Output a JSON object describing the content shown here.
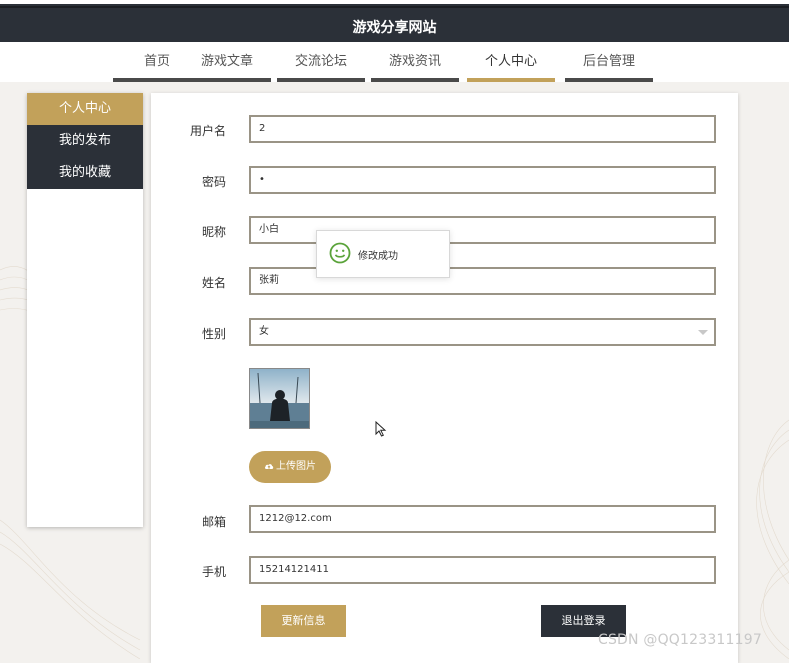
{
  "site": {
    "title": "游戏分享网站"
  },
  "nav": {
    "items": [
      {
        "label": "首页"
      },
      {
        "label": "游戏文章"
      },
      {
        "label": "交流论坛"
      },
      {
        "label": "游戏资讯"
      },
      {
        "label": "个人中心"
      },
      {
        "label": "后台管理"
      }
    ],
    "active": "个人中心"
  },
  "sidebar": {
    "items": [
      {
        "label": "个人中心"
      },
      {
        "label": "我的发布"
      },
      {
        "label": "我的收藏"
      }
    ]
  },
  "form": {
    "username": {
      "label": "用户名",
      "value": "2"
    },
    "password": {
      "label": "密码",
      "value": "•"
    },
    "nickname": {
      "label": "昵称",
      "value": "小白"
    },
    "name": {
      "label": "姓名",
      "value": "张莉"
    },
    "gender": {
      "label": "性别",
      "value": "女"
    },
    "upload_label": "上传图片",
    "email": {
      "label": "邮箱",
      "value": "1212@12.com"
    },
    "phone": {
      "label": "手机",
      "value": "15214121411"
    }
  },
  "buttons": {
    "update": "更新信息",
    "logout": "退出登录"
  },
  "toast": {
    "message": "修改成功",
    "icon": "smile-icon",
    "color": "#5aa33a"
  },
  "watermark": "CSDN @QQ123311197",
  "colors": {
    "accent": "#c2a15a",
    "dark": "#2b3038"
  }
}
